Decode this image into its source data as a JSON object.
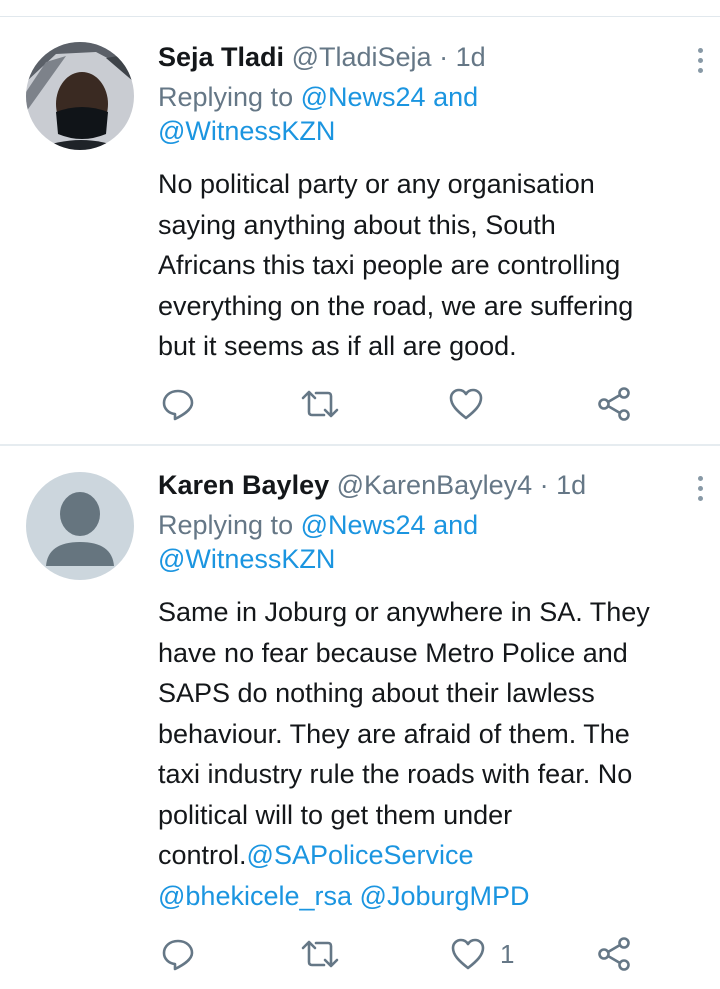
{
  "tweets": [
    {
      "name": "Seja Tladi",
      "handle": "@TladiSeja",
      "time": "· 1d",
      "replying_prefix": "Replying to ",
      "replying_to_1": "@News24",
      "replying_and": " and",
      "replying_to_2": "@WitnessKZN",
      "body_lines": [
        "No political party or any organisation",
        "saying anything about this, South",
        "Africans this taxi people are controlling",
        "everything on the road, we are suffering",
        "but it seems as if all are good."
      ],
      "like_count": ""
    },
    {
      "name": "Karen Bayley",
      "handle": "@KarenBayley4",
      "time": "· 1d",
      "replying_prefix": "Replying to ",
      "replying_to_1": "@News24",
      "replying_and": " and",
      "replying_to_2": "@WitnessKZN",
      "body_lines": [
        "Same in Joburg or anywhere in SA. They",
        "have no fear because Metro Police and",
        "SAPS do nothing about their lawless",
        "behaviour. They are afraid of them. The",
        "taxi industry rule the roads with fear. No",
        "political will to get them under"
      ],
      "body_line7_text": "control.",
      "body_line7_mention": "@SAPoliceService",
      "mention_bhekicele": "@bhekicele_rsa",
      "mention_joburgmpd": "@JoburgMPD",
      "like_count": "1"
    }
  ],
  "icons": [
    "reply-icon",
    "retweet-icon",
    "like-icon",
    "share-icon",
    "more-options-icon"
  ],
  "colors": {
    "link": "#1b95e0",
    "muted": "#657786",
    "icon": "#657786",
    "divider": "#e6ecf0"
  }
}
